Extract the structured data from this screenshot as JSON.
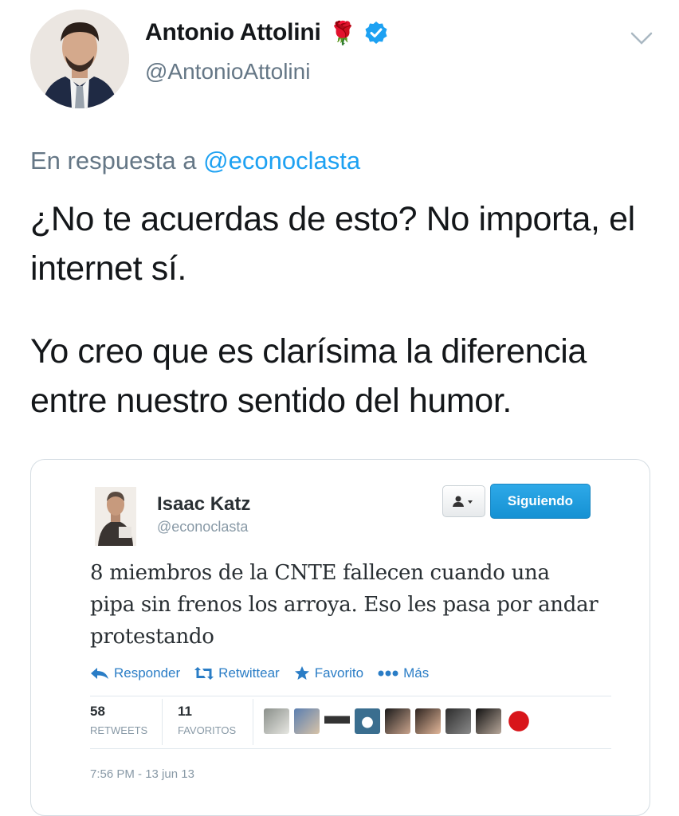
{
  "tweet": {
    "author_name": "Antonio Attolini",
    "name_emoji": "🌹",
    "handle": "@AntonioAttolini",
    "reply_prefix": "En respuesta a",
    "reply_to": "@econoclasta",
    "paragraph_1": "¿No te acuerdas de esto? No importa, el internet sí.",
    "paragraph_2": "Yo creo que es clarísima la diferencia entre nuestro sentido del humor."
  },
  "embedded": {
    "name": "Isaac Katz",
    "handle": "@econoclasta",
    "following_label": "Siguiendo",
    "text": "8 miembros de la CNTE fallecen cuando una pipa sin frenos los arroya. Eso les pasa por andar protestando",
    "actions": {
      "reply": "Responder",
      "retweet": "Retwittear",
      "favorite": "Favorito",
      "more": "Más"
    },
    "stats": {
      "retweets_count": "58",
      "retweets_label": "RETWEETS",
      "favorites_count": "11",
      "favorites_label": "FAVORITOS"
    },
    "timestamp": "7:56 PM - 13 jun 13"
  },
  "colors": {
    "verified": "#1da1f2",
    "link": "#1da1f2",
    "secondary_text": "#657786",
    "legacy_link": "#2a7dc6",
    "follow_button": "#1d9ad9"
  }
}
